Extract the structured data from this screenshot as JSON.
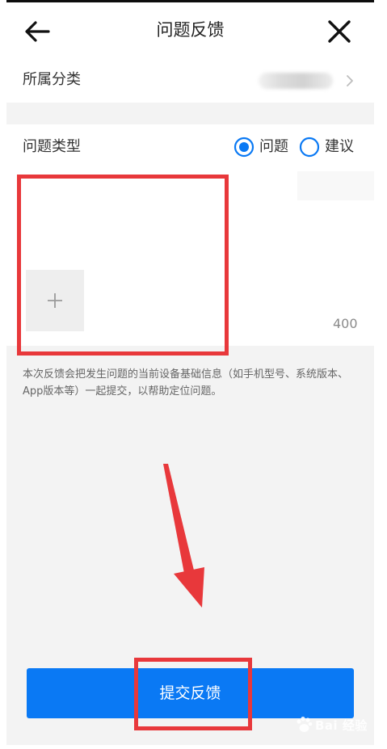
{
  "header": {
    "title": "问题反馈",
    "back_icon": "arrow-left-icon",
    "close_icon": "close-icon"
  },
  "category": {
    "label": "所属分类",
    "value_blurred": true,
    "chevron_icon": "chevron-right-icon"
  },
  "problem_type": {
    "label": "问题类型",
    "options": [
      {
        "label": "问题",
        "selected": true
      },
      {
        "label": "建议",
        "selected": false
      }
    ],
    "accent_color": "#0a79f4"
  },
  "content": {
    "description_value": "",
    "add_image_icon": "plus-icon",
    "char_limit": "400"
  },
  "notice": {
    "text": "本次反馈会把发生问题的当前设备基础信息（如手机型号、系统版本、App版本等）一起提交，以帮助定位问题。"
  },
  "submit": {
    "label": "提交反馈",
    "color": "#0a79f4"
  },
  "annotations": {
    "highlight_color": "#e8383b",
    "arrow_icon": "red-arrow-down-icon"
  },
  "watermark": {
    "text": "Bai 经验"
  }
}
